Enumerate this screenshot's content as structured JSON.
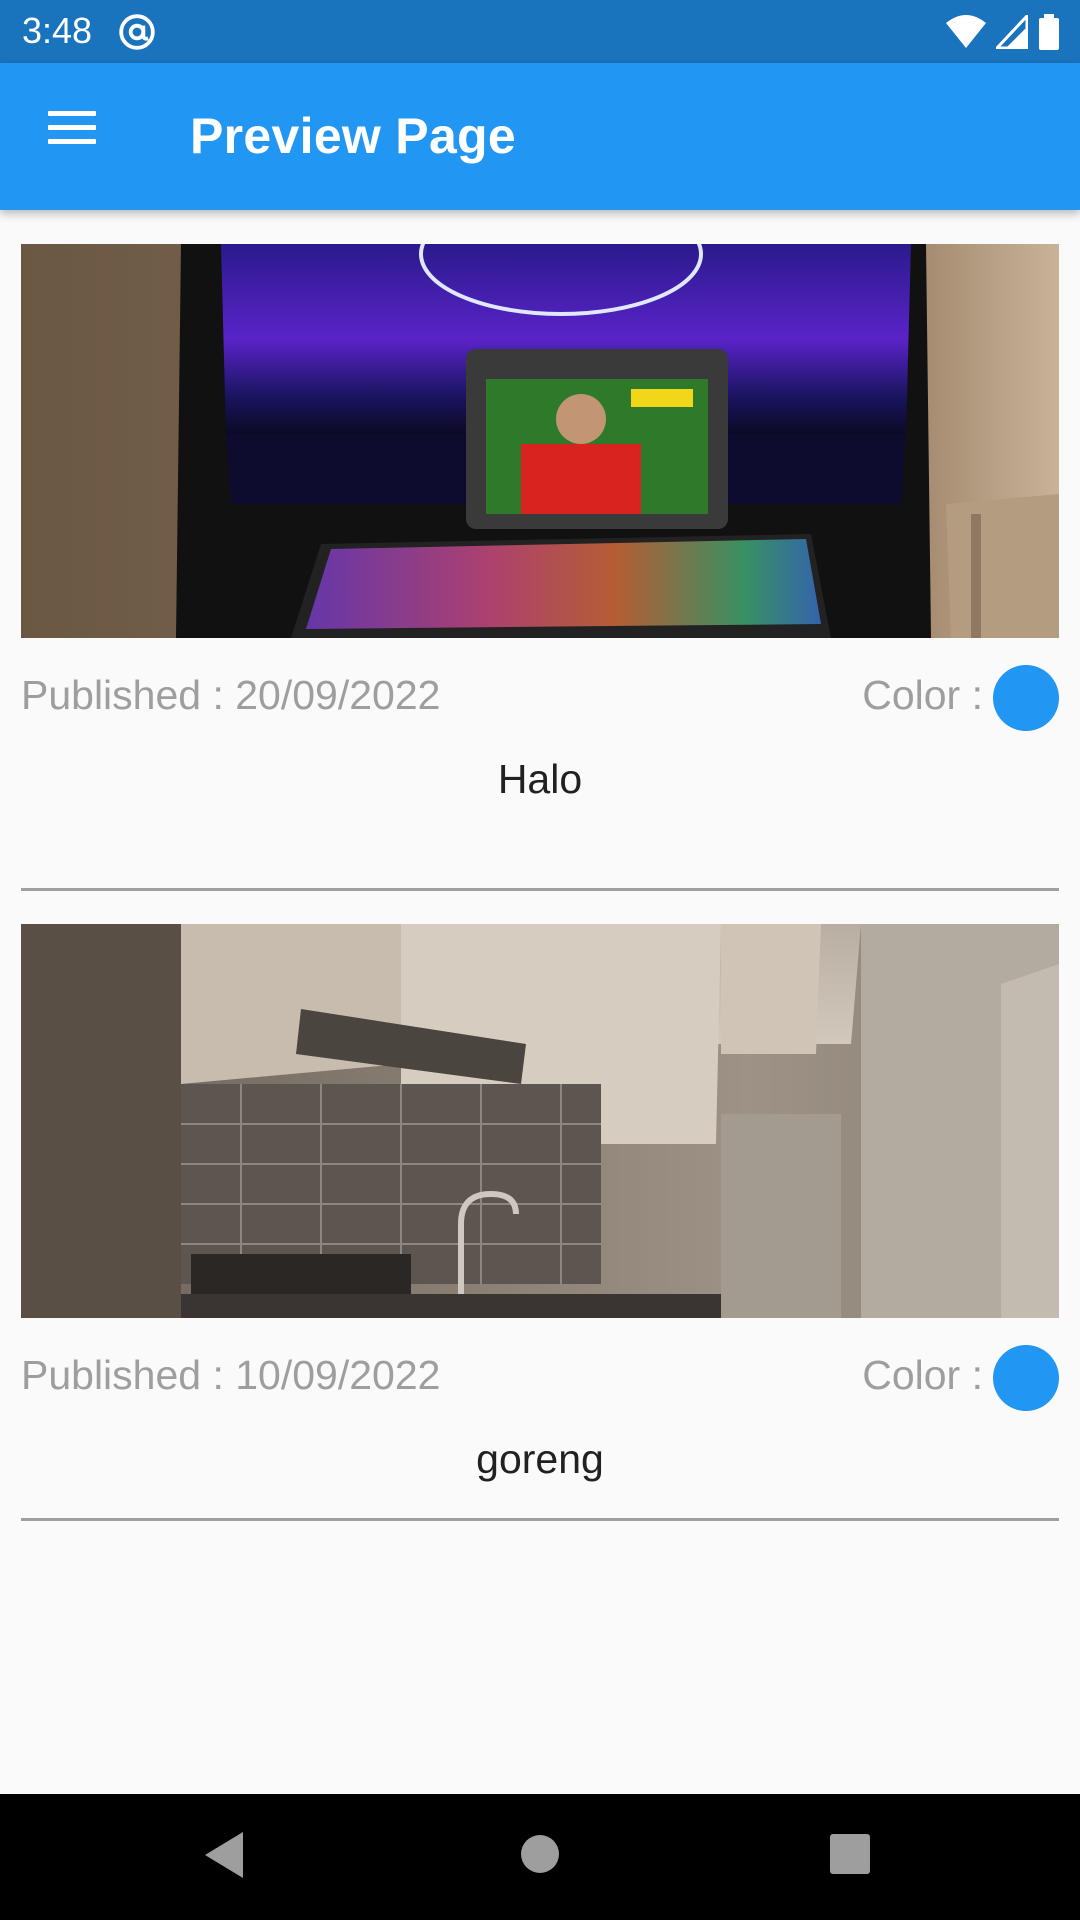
{
  "status_bar": {
    "time": "3:48",
    "icons": [
      "at-sign-icon",
      "wifi-icon",
      "signal-icon",
      "battery-icon"
    ]
  },
  "app_bar": {
    "title": "Preview Page",
    "menu_icon": "hamburger-menu-icon",
    "background": "#2196f3"
  },
  "cards": [
    {
      "image_desc": "gaming-setup-photo",
      "published": "Published : 20/09/2022",
      "color_label": "Color :",
      "color": "#2196f3",
      "title": "Halo"
    },
    {
      "image_desc": "kitchen-photo",
      "published": "Published : 10/09/2022",
      "color_label": "Color :",
      "color": "#2196f3",
      "title": "goreng"
    }
  ],
  "nav_bar": {
    "icons": [
      "back-icon",
      "home-icon",
      "recents-icon"
    ]
  }
}
